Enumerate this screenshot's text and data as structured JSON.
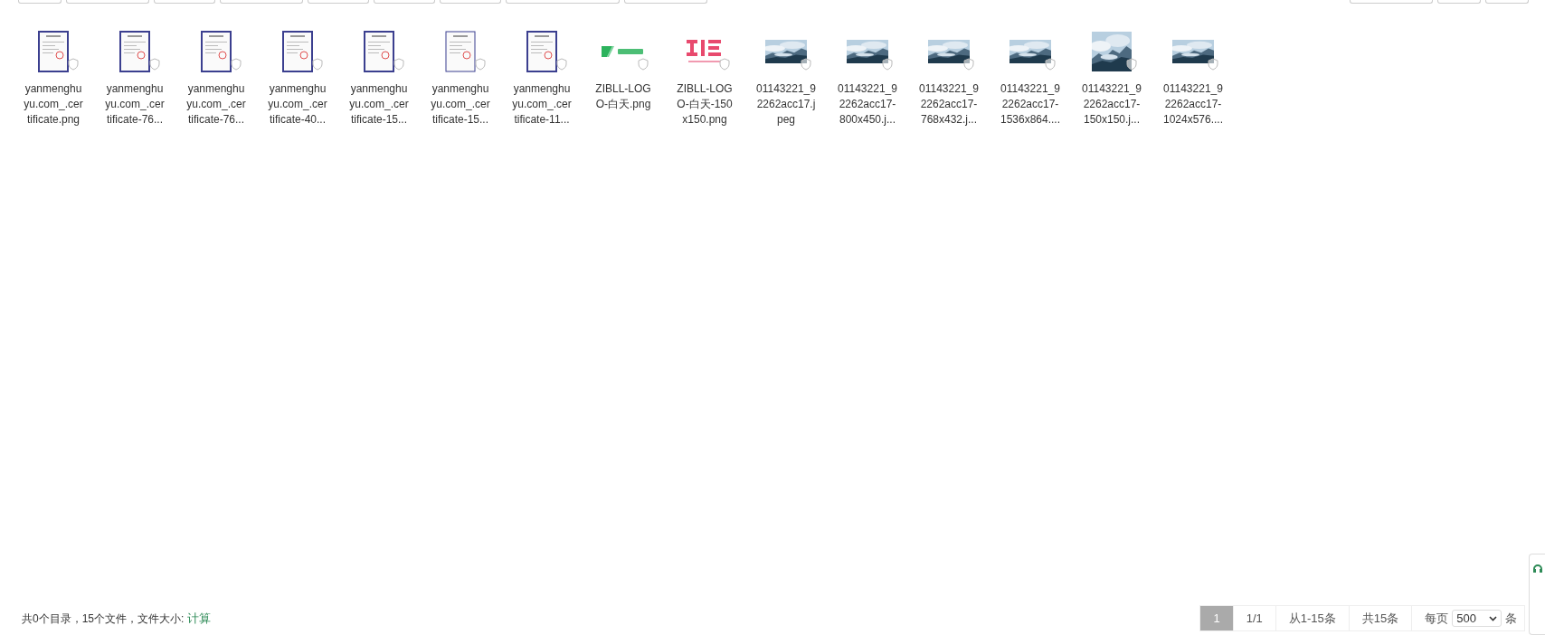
{
  "files": [
    {
      "kind": "certificate",
      "name_lines": [
        "yanmenghu",
        "yu.com_.cer",
        "tificate.png"
      ]
    },
    {
      "kind": "certificate",
      "name_lines": [
        "yanmenghu",
        "yu.com_.cer",
        "tificate-76..."
      ]
    },
    {
      "kind": "certificate",
      "name_lines": [
        "yanmenghu",
        "yu.com_.cer",
        "tificate-76..."
      ]
    },
    {
      "kind": "certificate",
      "name_lines": [
        "yanmenghu",
        "yu.com_.cer",
        "tificate-40..."
      ]
    },
    {
      "kind": "certificate",
      "name_lines": [
        "yanmenghu",
        "yu.com_.cer",
        "tificate-15..."
      ]
    },
    {
      "kind": "document",
      "name_lines": [
        "yanmenghu",
        "yu.com_.cer",
        "tificate-15..."
      ]
    },
    {
      "kind": "certificate",
      "name_lines": [
        "yanmenghu",
        "yu.com_.cer",
        "tificate-11..."
      ]
    },
    {
      "kind": "logo-wide",
      "name_lines": [
        "ZIBLL-LOG",
        "O-白天.png"
      ]
    },
    {
      "kind": "logo-square",
      "name_lines": [
        "ZIBLL-LOG",
        "O-白天-150",
        "x150.png"
      ]
    },
    {
      "kind": "photo-wide",
      "name_lines": [
        "01143221_9",
        "2262acc17.j",
        "peg"
      ]
    },
    {
      "kind": "photo-wide",
      "name_lines": [
        "01143221_9",
        "2262acc17-",
        "800x450.j..."
      ]
    },
    {
      "kind": "photo-wide",
      "name_lines": [
        "01143221_9",
        "2262acc17-",
        "768x432.j..."
      ]
    },
    {
      "kind": "photo-wide",
      "name_lines": [
        "01143221_9",
        "2262acc17-",
        "1536x864...."
      ]
    },
    {
      "kind": "photo-square",
      "name_lines": [
        "01143221_9",
        "2262acc17-",
        "150x150.j..."
      ]
    },
    {
      "kind": "photo-wide",
      "name_lines": [
        "01143221_9",
        "2262acc17-",
        "1024x576...."
      ]
    }
  ],
  "footer": {
    "summary": "共0个目录，15个文件，文件大小:",
    "calc_link": "计算"
  },
  "pagination": {
    "pages": [
      {
        "label": "1",
        "selected": true
      }
    ],
    "page_of": "1/1",
    "range": "从1-15条",
    "total": "共15条",
    "per_page_label": "每页",
    "per_page_value": "500",
    "per_page_unit": "条"
  }
}
